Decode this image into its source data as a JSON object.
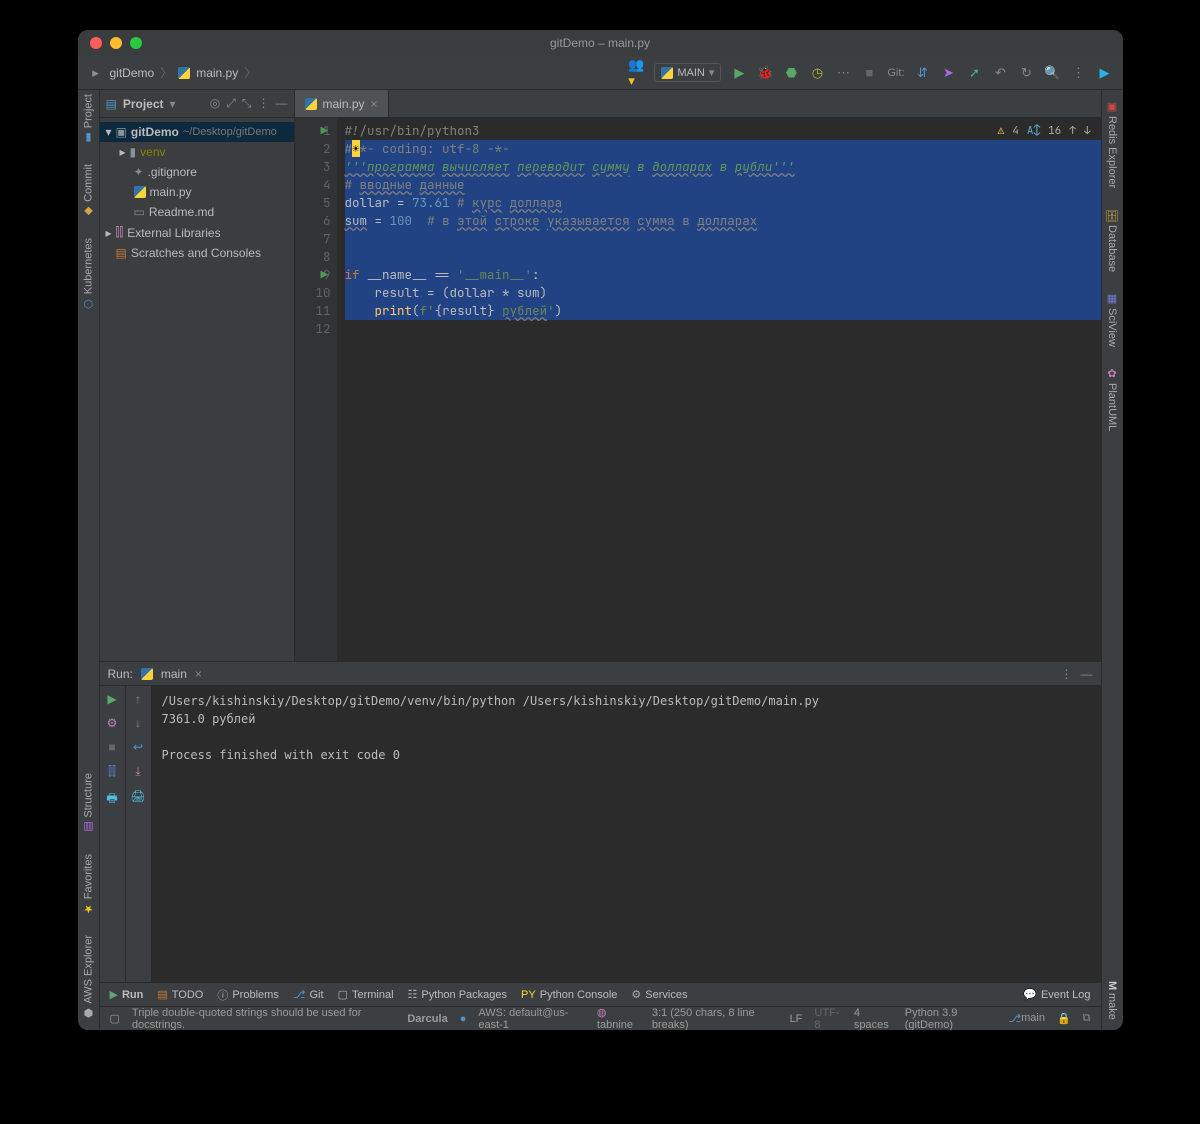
{
  "title": "gitDemo – main.py",
  "traffic_colors": {
    "close": "#ff5f57",
    "min": "#febc2e",
    "max": "#28c840"
  },
  "breadcrumb": {
    "root": "gitDemo",
    "file": "main.py"
  },
  "run_config": "MAIN",
  "navbar": {
    "git_label": "Git:"
  },
  "left_tools": [
    {
      "id": "project",
      "label": "Project",
      "color": "#4e94ce"
    },
    {
      "id": "commit",
      "label": "Commit",
      "color": "#d9a441"
    },
    {
      "id": "kubernetes",
      "label": "Kubernetes",
      "color": "#4a90d9"
    }
  ],
  "left_tools_bottom": [
    {
      "id": "structure",
      "label": "Structure",
      "color": "#b267e6"
    },
    {
      "id": "favorites",
      "label": "Favorites",
      "color": "#f5c518"
    },
    {
      "id": "aws-explorer",
      "label": "AWS Explorer",
      "color": "#aaaaaa"
    }
  ],
  "right_tools": [
    {
      "id": "redis-explorer",
      "label": "Redis Explorer",
      "color": "#d64541"
    },
    {
      "id": "database",
      "label": "Database",
      "color": "#d9a441"
    },
    {
      "id": "sciview",
      "label": "SciView",
      "color": "#6a7fd1"
    },
    {
      "id": "plantuml",
      "label": "PlantUML",
      "color": "#c77dbb"
    }
  ],
  "right_bottom": {
    "label": "make",
    "short": "M"
  },
  "project_panel": {
    "title": "Project",
    "root": {
      "name": "gitDemo",
      "path": "~/Desktop/gitDemo"
    },
    "venv": "venv",
    "files": [
      {
        "name": ".gitignore",
        "icon": "gitignore"
      },
      {
        "name": "main.py",
        "icon": "python"
      },
      {
        "name": "Readme.md",
        "icon": "markdown"
      }
    ],
    "libs": "External Libraries",
    "scratch": "Scratches and Consoles"
  },
  "editor": {
    "tab": "main.py",
    "lines": [
      "#!/usr/bin/python3",
      "#**- coding: utf-8 -*-",
      "'''программа вычисляет переводит сумму в долларах в рубли'''",
      "# вводные данные",
      "dollar = 73.61 # курс доллара",
      "sum = 100  # в этой строке указывается сумма в долларах",
      "",
      "",
      "if __name__ == '__main__':",
      "    result = (dollar * sum)",
      "    print(f'{result} рублей')",
      ""
    ],
    "indicators": {
      "warn_icon": "⚠",
      "warn": "4",
      "typo_icon": "A↕",
      "typo": "16",
      "up": "↑",
      "down": "↓"
    }
  },
  "run_panel": {
    "label": "Run:",
    "config": "main",
    "out_cmd": "/Users/kishinskiy/Desktop/gitDemo/venv/bin/python /Users/kishinskiy/Desktop/gitDemo/main.py",
    "out_result": "7361.0 рублей",
    "out_exit": "Process finished with exit code 0"
  },
  "bottombar": {
    "items": [
      {
        "id": "run",
        "label": "Run",
        "color": "#59a869"
      },
      {
        "id": "todo",
        "label": "TODO",
        "color": "#cc7832"
      },
      {
        "id": "problems",
        "label": "Problems",
        "color": "#aaaaaa"
      },
      {
        "id": "git",
        "label": "Git",
        "color": "#4e94ce"
      },
      {
        "id": "terminal",
        "label": "Terminal",
        "color": "#aaaaaa"
      },
      {
        "id": "python-packages",
        "label": "Python Packages",
        "color": "#aaaaaa"
      },
      {
        "id": "python-console",
        "label": "Python Console",
        "color": "#ffd43b"
      },
      {
        "id": "services",
        "label": "Services",
        "color": "#aaaaaa"
      }
    ],
    "event_log": "Event Log"
  },
  "statusbar": {
    "hint": "Triple double-quoted strings should be used for docstrings.",
    "theme": "Darcula",
    "aws": "AWS: default@us-east-1",
    "tabnine": "tabnine",
    "cursor": "3:1 (250 chars, 8 line breaks)",
    "sep": "LF",
    "enc": "UTF-8",
    "indent": "4 spaces",
    "python": "Python 3.9 (gitDemo)",
    "branch": "main"
  }
}
